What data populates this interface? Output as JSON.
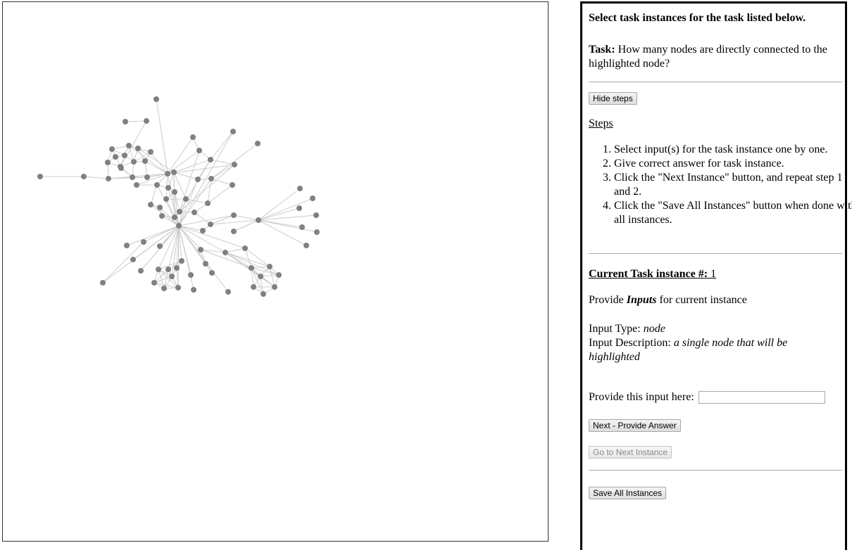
{
  "task_panel": {
    "heading": "Select task instances for the task listed below.",
    "task_label": "Task:",
    "task_text": "How many nodes are directly connected to the highlighted node?",
    "hide_steps_label": "Hide steps",
    "steps_title": "Steps",
    "steps": [
      "Select input(s) for the task instance one by one.",
      "Give correct answer for task instance.",
      "Click the \"Next Instance\" button, and repeat step 1 and 2.",
      "Click the \"Save All Instances\" button when done with all instances."
    ],
    "current_instance_label": "Current Task instance #:",
    "current_instance_number": "1",
    "provide_prefix": "Provide",
    "provide_emph": "Inputs",
    "provide_suffix": "for current instance",
    "input_type_label": "Input Type:",
    "input_type_value": "node",
    "input_desc_label": "Input Description:",
    "input_desc_value": "a single node that will be highlighted",
    "provide_here_label": "Provide this input here:",
    "input_value": "",
    "next_answer_label": "Next - Provide Answer",
    "next_instance_label": "Go to Next Instance",
    "save_all_label": "Save All Instances"
  },
  "graph": {
    "node_color": "#808080",
    "edge_color": "#cccccc"
  }
}
